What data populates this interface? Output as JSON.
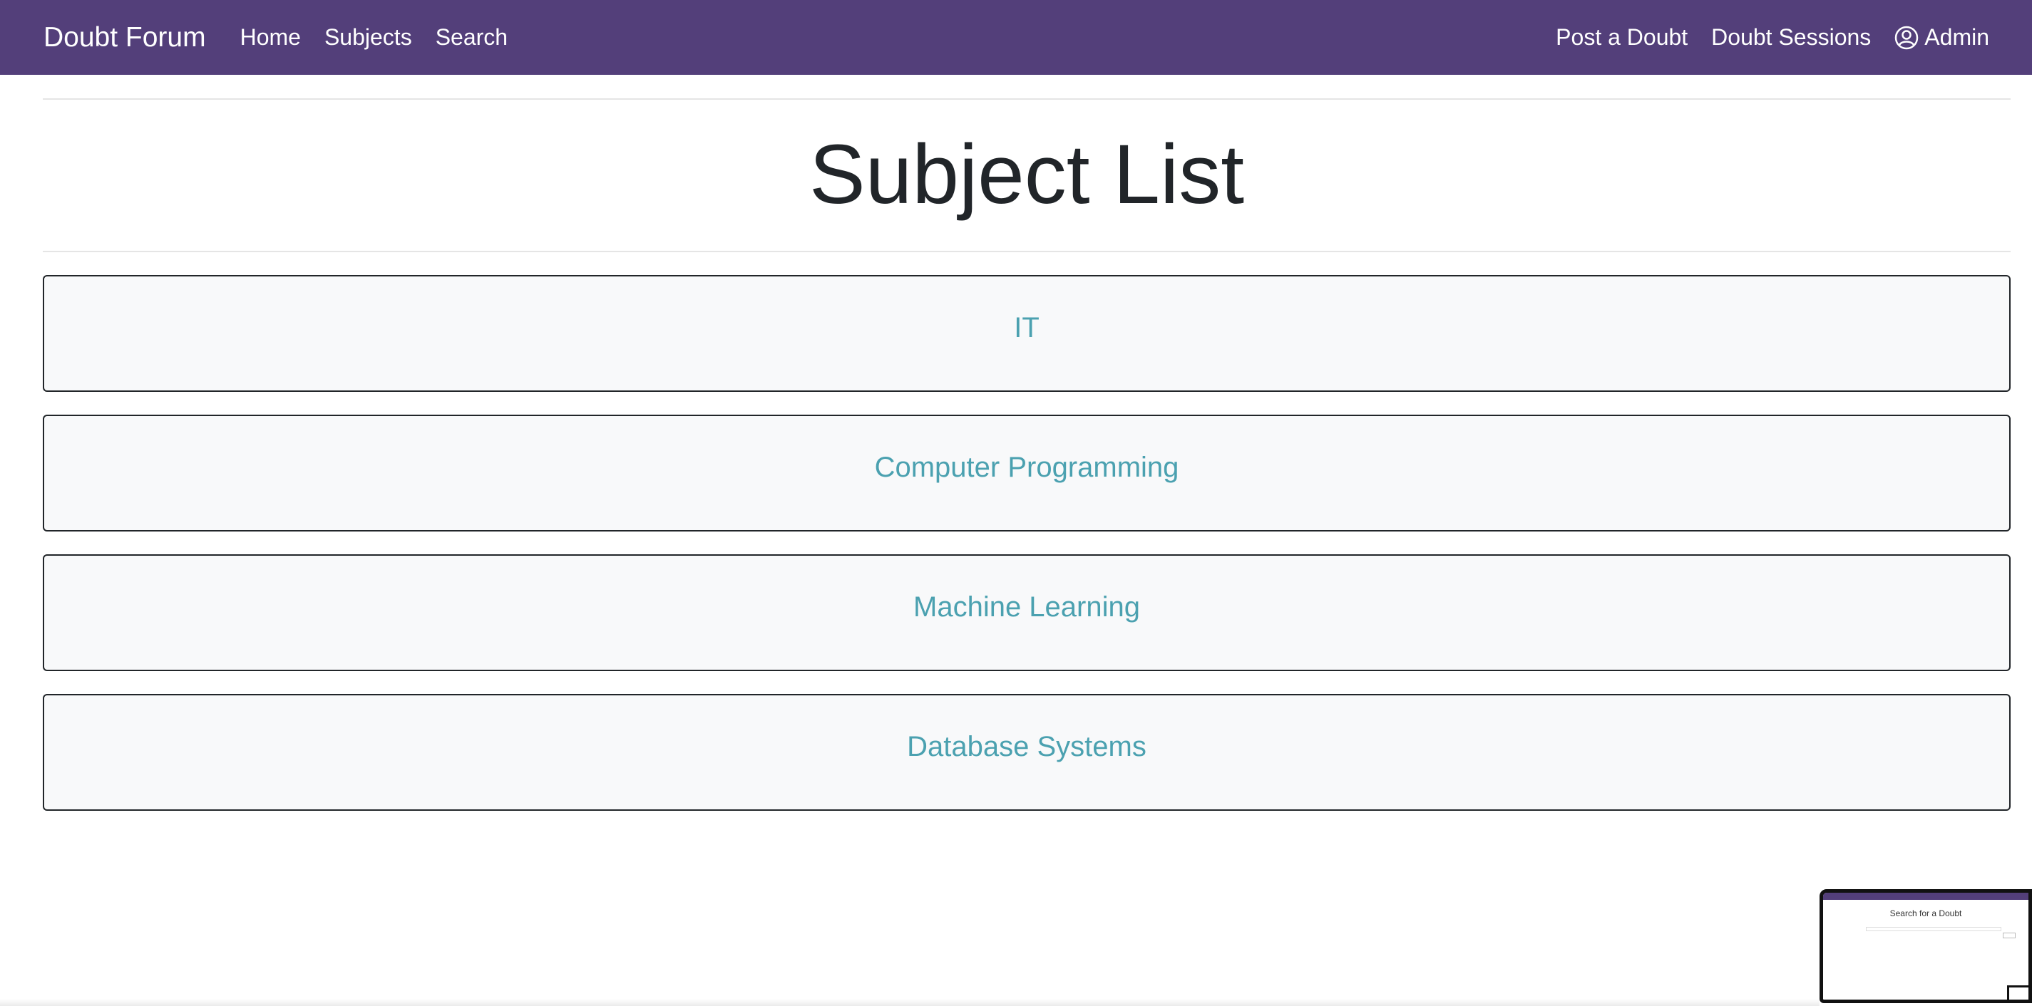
{
  "navbar": {
    "brand": "Doubt Forum",
    "left_links": [
      "Home",
      "Subjects",
      "Search"
    ],
    "right_links": {
      "post": "Post a Doubt",
      "sessions": "Doubt Sessions",
      "user": "Admin"
    },
    "background_color": "#533f7a"
  },
  "main": {
    "title": "Subject List",
    "subjects": [
      "IT",
      "Computer Programming",
      "Machine Learning",
      "Database Systems"
    ],
    "link_color": "#4ba1b0"
  },
  "preview_thumbnail": {
    "title": "Search for a Doubt"
  }
}
